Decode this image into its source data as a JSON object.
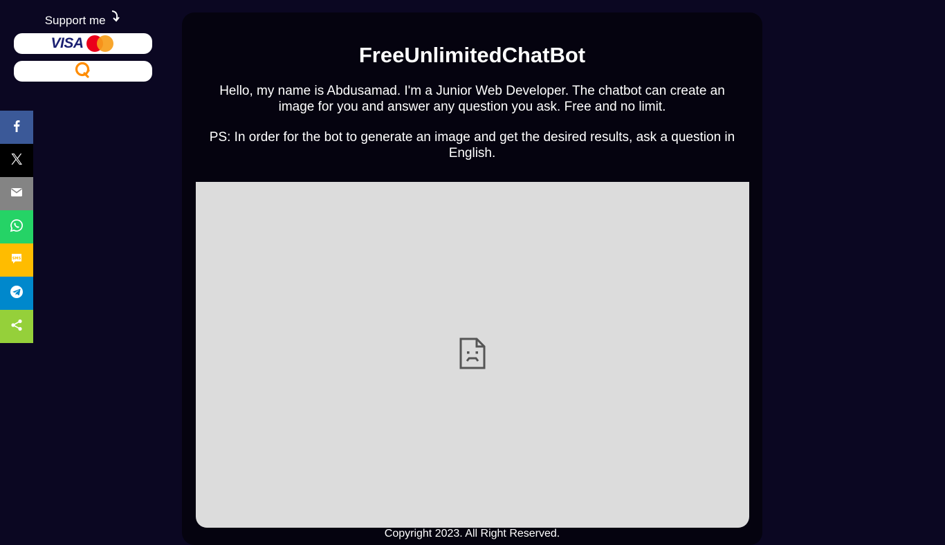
{
  "support": {
    "title": "Support me",
    "arrow_icon": "curved-arrow-down-icon",
    "buttons": [
      {
        "name": "visa-mastercard",
        "visa_label": "VISA",
        "icon": "mastercard-icon"
      },
      {
        "name": "qiwi",
        "icon": "qiwi-icon"
      }
    ]
  },
  "share": {
    "items": [
      {
        "name": "facebook",
        "icon": "facebook-icon",
        "color": "#3b5998"
      },
      {
        "name": "x",
        "icon": "x-icon",
        "color": "#000000"
      },
      {
        "name": "email",
        "icon": "email-icon",
        "color": "#848484"
      },
      {
        "name": "whatsapp",
        "icon": "whatsapp-icon",
        "color": "#25d366"
      },
      {
        "name": "sms",
        "icon": "sms-icon",
        "color": "#ffbc00"
      },
      {
        "name": "telegram",
        "icon": "telegram-icon",
        "color": "#0088cc"
      },
      {
        "name": "share",
        "icon": "share-icon",
        "color": "#95d03a"
      }
    ]
  },
  "main": {
    "title": "FreeUnlimitedChatBot",
    "intro": "Hello, my name is Abdusamad. I'm a Junior Web Developer. The chatbot can create an image for you and answer any question you ask. Free and no limit.",
    "ps": "PS: In order for the bot to generate an image and get the desired results, ask a question in English.",
    "frame_icon": "broken-document-icon",
    "copyright": "Copyright 2023. All Right Reserved."
  },
  "colors": {
    "background": "#0b0722",
    "card": "#05030f",
    "frame": "#dcdcdc"
  }
}
